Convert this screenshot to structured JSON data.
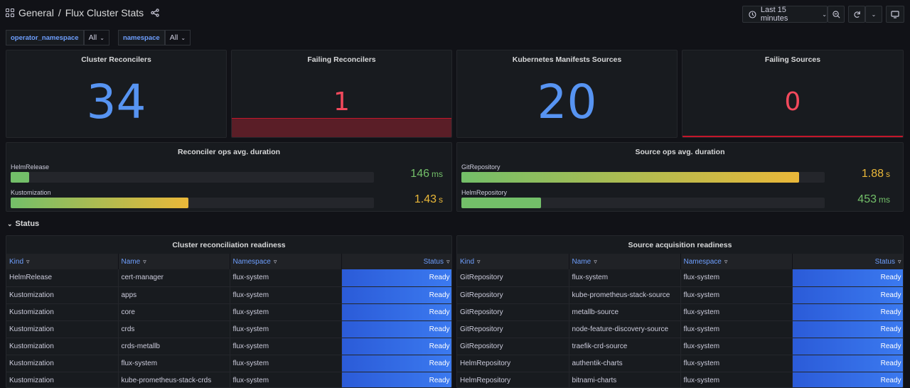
{
  "header": {
    "folder": "General",
    "dashboard": "Flux Cluster Stats",
    "time_range": "Last 15 minutes"
  },
  "variables": [
    {
      "name": "operator_namespace",
      "value": "All"
    },
    {
      "name": "namespace",
      "value": "All"
    }
  ],
  "stats": {
    "cluster_reconcilers": {
      "title": "Cluster Reconcilers",
      "value": "34"
    },
    "failing_reconcilers": {
      "title": "Failing Reconcilers",
      "value": "1"
    },
    "manifest_sources": {
      "title": "Kubernetes Manifests Sources",
      "value": "20"
    },
    "failing_sources": {
      "title": "Failing Sources",
      "value": "0"
    }
  },
  "reconciler_ops": {
    "title": "Reconciler ops avg. duration",
    "items": [
      {
        "label": "HelmRelease",
        "value": "146",
        "unit": "ms",
        "fill_fraction": 0.05,
        "color": "#73bf69"
      },
      {
        "label": "Kustomization",
        "value": "1.43",
        "unit": "s",
        "fill_fraction": 0.49,
        "color": "#eab839"
      }
    ]
  },
  "source_ops": {
    "title": "Source ops avg. duration",
    "items": [
      {
        "label": "GitRepository",
        "value": "1.88",
        "unit": "s",
        "fill_fraction": 0.93,
        "color": "#eab839"
      },
      {
        "label": "HelmRepository",
        "value": "453",
        "unit": "ms",
        "fill_fraction": 0.22,
        "color": "#73bf69"
      }
    ]
  },
  "status_row": {
    "label": "Status"
  },
  "cluster_table": {
    "title": "Cluster reconciliation readiness",
    "columns": [
      "Kind",
      "Name",
      "Namespace",
      "Status"
    ],
    "rows": [
      [
        "HelmRelease",
        "cert-manager",
        "flux-system",
        "Ready"
      ],
      [
        "Kustomization",
        "apps",
        "flux-system",
        "Ready"
      ],
      [
        "Kustomization",
        "core",
        "flux-system",
        "Ready"
      ],
      [
        "Kustomization",
        "crds",
        "flux-system",
        "Ready"
      ],
      [
        "Kustomization",
        "crds-metallb",
        "flux-system",
        "Ready"
      ],
      [
        "Kustomization",
        "flux-system",
        "flux-system",
        "Ready"
      ],
      [
        "Kustomization",
        "kube-prometheus-stack-crds",
        "flux-system",
        "Ready"
      ]
    ]
  },
  "source_table": {
    "title": "Source acquisition readiness",
    "columns": [
      "Kind",
      "Name",
      "Namespace",
      "Status"
    ],
    "rows": [
      [
        "GitRepository",
        "flux-system",
        "flux-system",
        "Ready"
      ],
      [
        "GitRepository",
        "kube-prometheus-stack-source",
        "flux-system",
        "Ready"
      ],
      [
        "GitRepository",
        "metallb-source",
        "flux-system",
        "Ready"
      ],
      [
        "GitRepository",
        "node-feature-discovery-source",
        "flux-system",
        "Ready"
      ],
      [
        "GitRepository",
        "traefik-crd-source",
        "flux-system",
        "Ready"
      ],
      [
        "HelmRepository",
        "authentik-charts",
        "flux-system",
        "Ready"
      ],
      [
        "HelmRepository",
        "bitnami-charts",
        "flux-system",
        "Ready"
      ]
    ]
  },
  "colors": {
    "stat_blue": "#5794f2",
    "stat_red": "#f2495c",
    "status_blue": "#3274d9"
  }
}
